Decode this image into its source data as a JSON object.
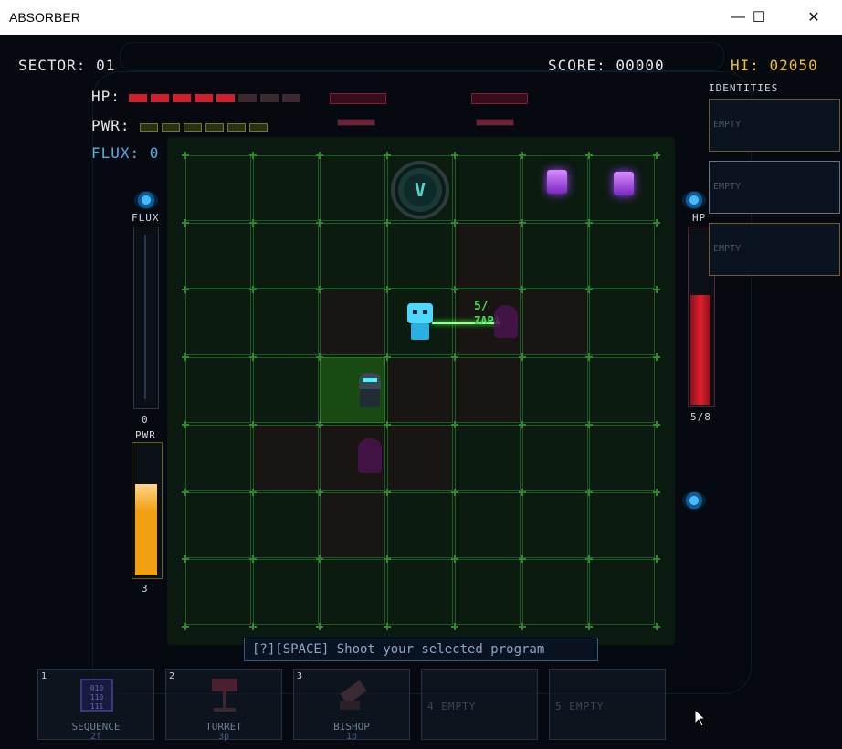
{
  "window": {
    "title": "ABSORBER",
    "minimize_icon": "—",
    "maximize_icon": "☐",
    "close_icon": "✕"
  },
  "hud": {
    "sector_label": "SECTOR: 01",
    "score_label": "SCORE: 00000",
    "hi_label": "HI: 02050",
    "hp_label": "HP:",
    "hp_fraction": 0.625,
    "pwr_label": "PWR:",
    "flux_label": "FLUX: 0"
  },
  "colors": {
    "accent_cyan": "#4fb3e8",
    "hi_yellow": "#f0c020",
    "hp_red": "#d01f2d",
    "pwr_orange": "#f0a010",
    "grid_green": "#2f8a2f"
  },
  "left_panel": {
    "flux_title": "FLUX",
    "flux_value": "0",
    "flux_fraction": 0,
    "pwr_title": "PWR",
    "pwr_value": "3",
    "pwr_fraction": 0.7
  },
  "right_panel": {
    "hp_title": "HP",
    "hp_value": "5/8",
    "hp_fraction": 0.625
  },
  "identities": {
    "title": "IDENTITIES",
    "slots": [
      "EMPTY",
      "EMPTY",
      "EMPTY"
    ]
  },
  "board": {
    "floating_text_1": "5/",
    "floating_text_2": "ZAP!",
    "vault_letter": "V"
  },
  "hint": {
    "text": "[?][SPACE] Shoot your selected program"
  },
  "programs": [
    {
      "num": "1",
      "name": "SEQUENCE",
      "cost": "2f",
      "icon": "chip-icon",
      "chip_text": "010\n110\n111"
    },
    {
      "num": "2",
      "name": "TURRET",
      "cost": "3p",
      "icon": "turret-icon"
    },
    {
      "num": "3",
      "name": "BISHOP",
      "cost": "1p",
      "icon": "bishop-icon"
    },
    {
      "num": "",
      "name": "",
      "cost": "",
      "empty_label": "4 EMPTY"
    },
    {
      "num": "",
      "name": "",
      "cost": "",
      "empty_label": "5 EMPTY"
    }
  ]
}
